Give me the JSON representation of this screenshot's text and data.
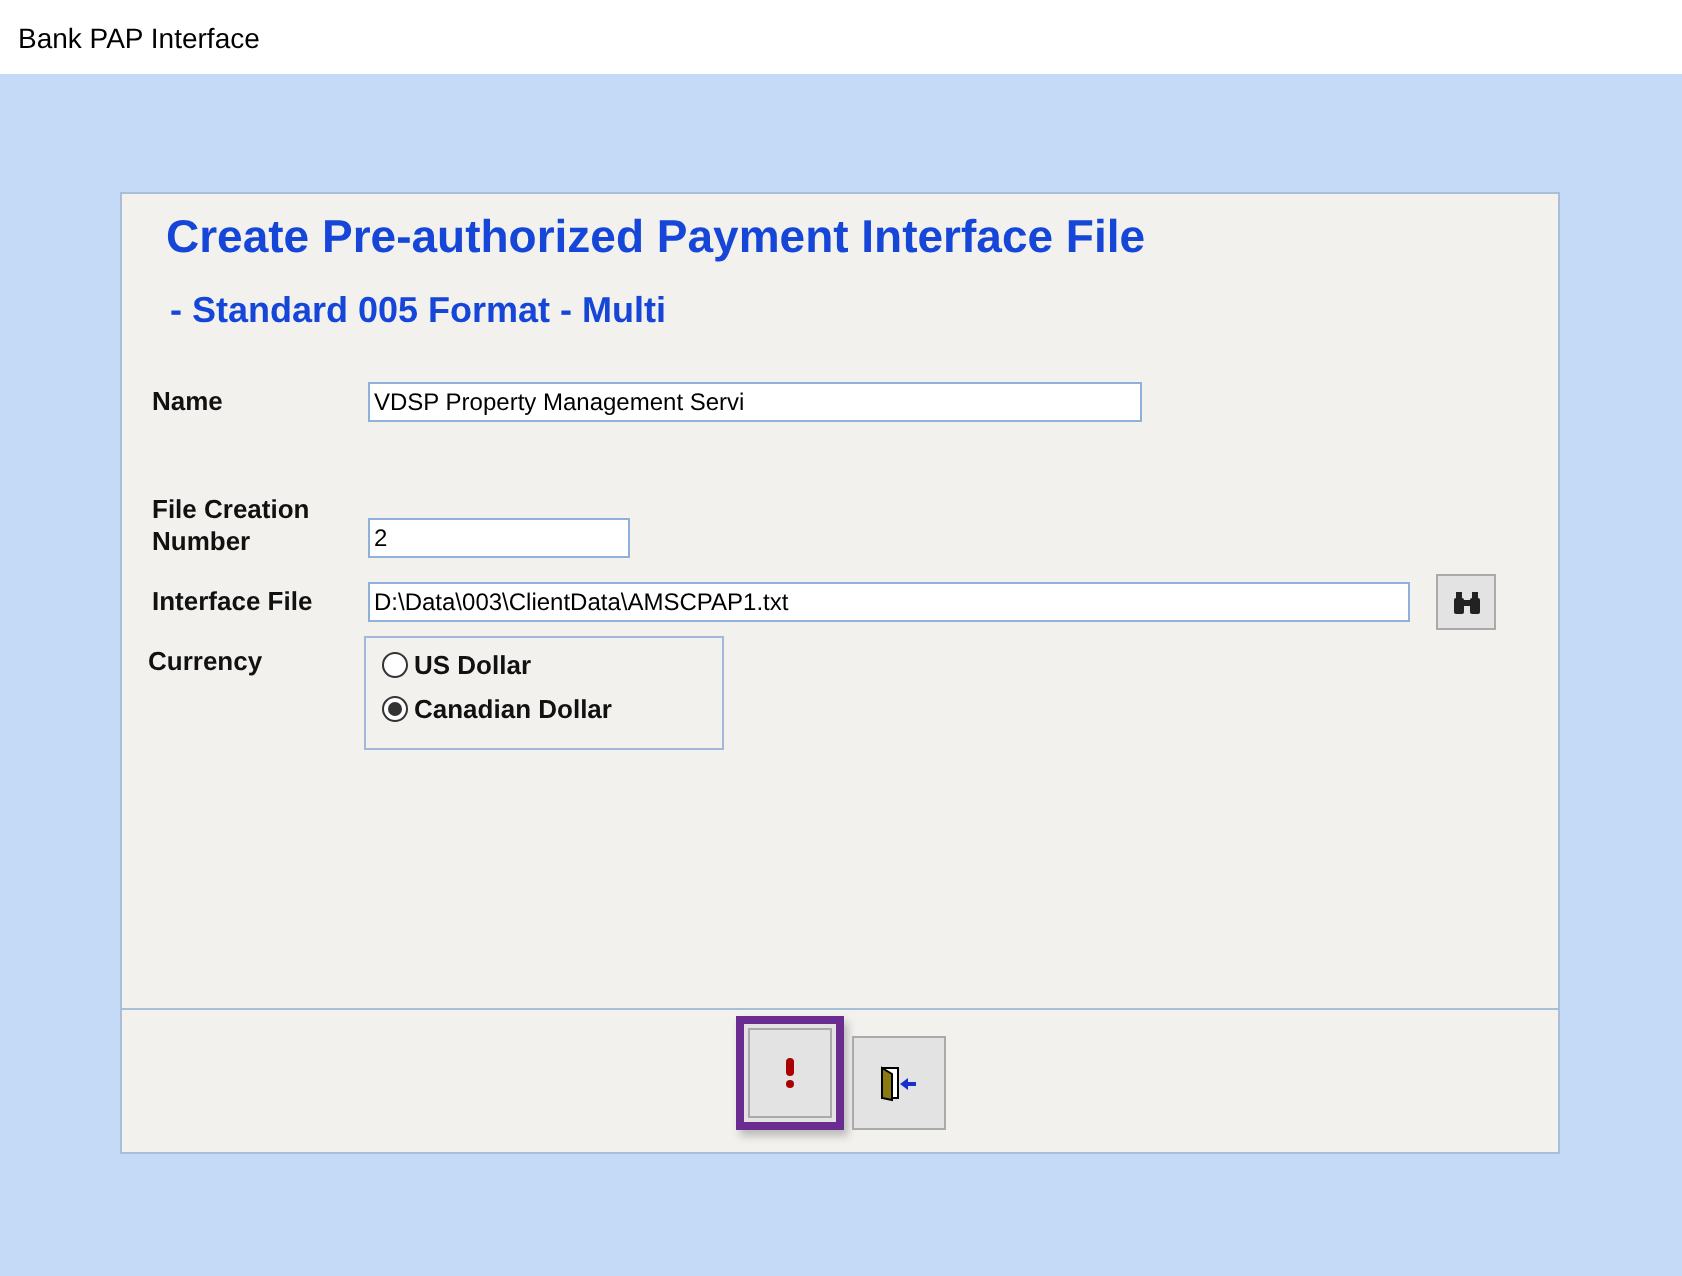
{
  "window": {
    "title": "Bank PAP Interface"
  },
  "heading": {
    "title": "Create Pre-authorized Payment Interface File",
    "subtitle": "- Standard 005 Format - Multi"
  },
  "fields": [
    {
      "label": "Name",
      "value": "VDSP Property Management Servi"
    },
    {
      "label": "File Creation Number",
      "value": "2"
    },
    {
      "label": "Interface File",
      "value": "D:\\Data\\003\\ClientData\\AMSCPAP1.txt"
    }
  ],
  "currency": {
    "label": "Currency",
    "options": [
      {
        "label": "US Dollar",
        "selected": false
      },
      {
        "label": "Canadian Dollar",
        "selected": true
      }
    ]
  },
  "buttons": [
    {
      "kind": "run",
      "focused": true
    },
    {
      "kind": "exit",
      "focused": false
    }
  ]
}
